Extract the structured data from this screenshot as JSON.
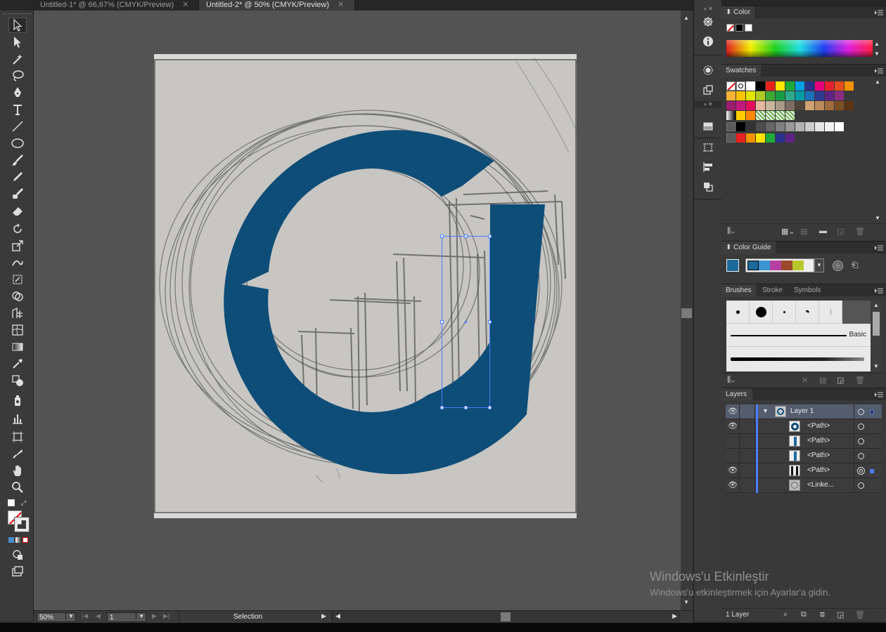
{
  "tabs": [
    {
      "label": "Untitled-1* @ 66,67% (CMYK/Preview)",
      "active": false
    },
    {
      "label": "Untitled-2* @ 50% (CMYK/Preview)",
      "active": true
    }
  ],
  "tab_close": "✕",
  "status": {
    "zoom": "50%",
    "artboard": "1",
    "tool": "Selection"
  },
  "panels": {
    "color": {
      "title": "Color"
    },
    "swatches": {
      "title": "Swatches"
    },
    "color_guide": {
      "title": "Color Guide"
    },
    "brushes": {
      "tabs": [
        "Brushes",
        "Stroke",
        "Symbols"
      ],
      "basic_label": "Basic"
    },
    "layers": {
      "title": "Layers",
      "rows": [
        {
          "name": "Layer 1",
          "visible": true
        },
        {
          "name": "<Path>",
          "visible": true
        },
        {
          "name": "<Path>",
          "visible": false
        },
        {
          "name": "<Path>",
          "visible": false
        },
        {
          "name": "<Path>",
          "visible": true
        },
        {
          "name": "<Linke...",
          "visible": true
        }
      ],
      "count": "1 Layer"
    }
  },
  "watermark": {
    "line1": "Windows'u Etkinleştir",
    "line2": "Windows'u etkinleştirmek için Ayarlar'a gidin."
  },
  "colors": {
    "logo_blue": "#0e4d77",
    "selection": "#4a7cff",
    "ui_dark": "#3a3a3a",
    "canvas": "#535353"
  },
  "tools": [
    "selection-icon",
    "direct-selection-icon",
    "magic-wand-icon",
    "lasso-icon",
    "pen-icon",
    "type-icon",
    "line-icon",
    "ellipse-icon",
    "paintbrush-icon",
    "pencil-icon",
    "blob-brush-icon",
    "eraser-icon",
    "rotate-icon",
    "scale-icon",
    "warp-icon",
    "free-transform-icon",
    "shape-builder-icon",
    "perspective-icon",
    "mesh-icon",
    "gradient-icon",
    "eyedropper-icon",
    "blend-icon",
    "symbol-sprayer-icon",
    "column-graph-icon",
    "artboard-icon",
    "slice-icon",
    "hand-icon",
    "zoom-icon"
  ]
}
